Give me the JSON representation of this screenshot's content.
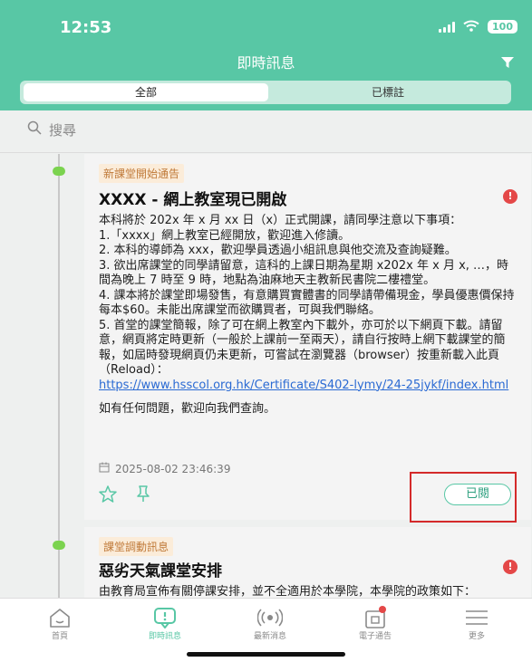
{
  "status_bar": {
    "time": "12:53",
    "battery": "100"
  },
  "nav": {
    "title": "即時訊息"
  },
  "segments": {
    "all": "全部",
    "marked": "已標註"
  },
  "search": {
    "placeholder": "搜尋"
  },
  "messages": [
    {
      "tag": "新課堂開始通告",
      "title": "XXXX - 網上教室現已開啟",
      "body": [
        "本科將於 202x 年 x 月 xx 日（x）正式開課，請同學注意以下事項：",
        "1.「xxxx」網上教室已經開放，歡迎進入修讀。",
        "2. 本科的導師為 xxx，歡迎學員透過小組訊息與他交流及查詢疑難。",
        "3. 欲出席課堂的同學請留意，這科的上課日期為星期 x202x 年 x 月 x, …，時間為晚上 7 時至 9 時，地點為油麻地天主教新民書院二樓禮堂。",
        "4. 課本將於課堂即場發售，有意購買實體書的同學請帶備現金，學員優惠價保持每本$60。未能出席課堂而欲購買者，可與我們聯絡。",
        "5. 首堂的課堂簡報，除了可在網上教室內下載外，亦可於以下網頁下載。請留意，網頁將定時更新（一般於上課前一至兩天），請自行按時上網下載課堂的簡報，如屆時發現網頁仍未更新，可嘗試在瀏覽器（browser）按重新載入此頁（Reload）："
      ],
      "link": "https://www.hsscol.org.hk/Certificate/S402-lymy/24-25jykf/index.html",
      "closing": "如有任何問題，歡迎向我們查詢。",
      "timestamp": "2025-08-02 23:46:39",
      "read_label": "已閱"
    },
    {
      "tag": "課堂調動訊息",
      "title": "惡劣天氣課堂安排",
      "body": [
        "由教育局宣佈有關停課安排，並不全適用於本學院，本學院的政策如下："
      ]
    }
  ],
  "bottom_nav": [
    {
      "label": "首頁",
      "icon": "home-icon"
    },
    {
      "label": "即時訊息",
      "icon": "message-alert-icon"
    },
    {
      "label": "最新消息",
      "icon": "broadcast-icon"
    },
    {
      "label": "電子通告",
      "icon": "notice-board-icon"
    },
    {
      "label": "更多",
      "icon": "menu-icon"
    }
  ],
  "colors": {
    "accent": "#58c7a5",
    "alert": "#e44848",
    "tag_bg": "#fbecd9",
    "tag_text": "#c07a39",
    "link": "#2a6ad3",
    "highlight": "#d42a2a"
  }
}
